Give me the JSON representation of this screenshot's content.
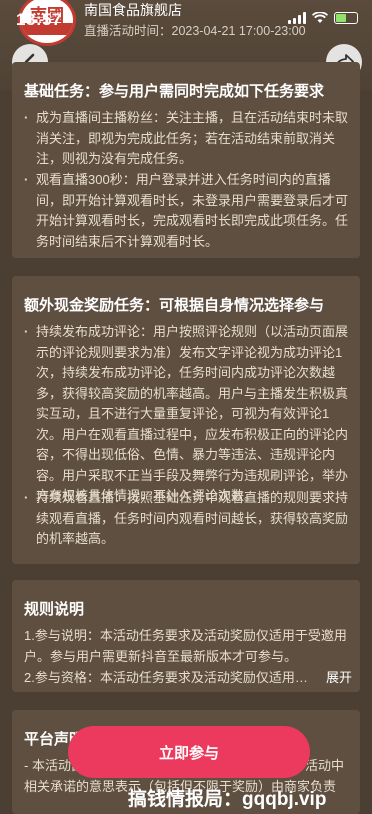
{
  "status_bar": {
    "time": "18:57"
  },
  "header": {
    "logo_text": "南國",
    "shop_name": "南国食品旗舰店",
    "live_time": "直播活动时间：2023-04-21 17:00-23:00"
  },
  "basic_tasks": {
    "title": "基础任务：参与用户需同时完成如下任务要求",
    "items": [
      "成为直播间主播粉丝：关注主播，且在活动结束时未取消关注，即视为完成此任务；若在活动结束前取消关注，则视为没有完成任务。",
      "观看直播300秒：用户登录并进入任务时间内的直播间，即开始计算观看时长，未登录用户需要登录后才可开始计算观看时长，完成观看时长即完成此项任务。任务时间结束后不计算观看时长。"
    ]
  },
  "extra_tasks": {
    "title": "额外现金奖励任务：可根据自身情况选择参与",
    "items": [
      "持续发布成功评论：用户按照评论规则（以活动页面展示的评论规则要求为准）发布文字评论视为成功评论1次，持续发布成功评论，任务时间内成功评论次数越多，获得较高奖励的机率越高。用户与主播发生积极真实互动，且不进行大量重复评论，可视为有效评论1次。用户在观看直播过程中，应发布积极正向的评论内容，不得出现低俗、色情、暴力等违法、违规评论内容。用户采取不正当手段及舞弊行为违规刷评论，举办方有权核具体情况，不计入评论次数。",
      "持续观看直播：按照基础任务中观看直播的规则要求持续观看直播，任务时间内观看时间越长，获得较高奖励的机率越高。"
    ]
  },
  "rules": {
    "title": "规则说明",
    "para1": "1.参与说明：本活动任务要求及活动奖励仅适用于受邀用户。参与用户需更新抖音至最新版本才可参与。",
    "para2": "2.参与资格：本活动任务要求及活动奖励仅适用…",
    "expand_label": "展开"
  },
  "platform": {
    "title": "平台声明",
    "para": "- 本活动由商家举办，抖音平台仅提供技术服务，活动中相关承诺的意思表示（包括但不限于奖励）由商家负责"
  },
  "join_button": {
    "label": "立即参与"
  },
  "watermark": "搞钱情报局：gqqbj.vip"
}
